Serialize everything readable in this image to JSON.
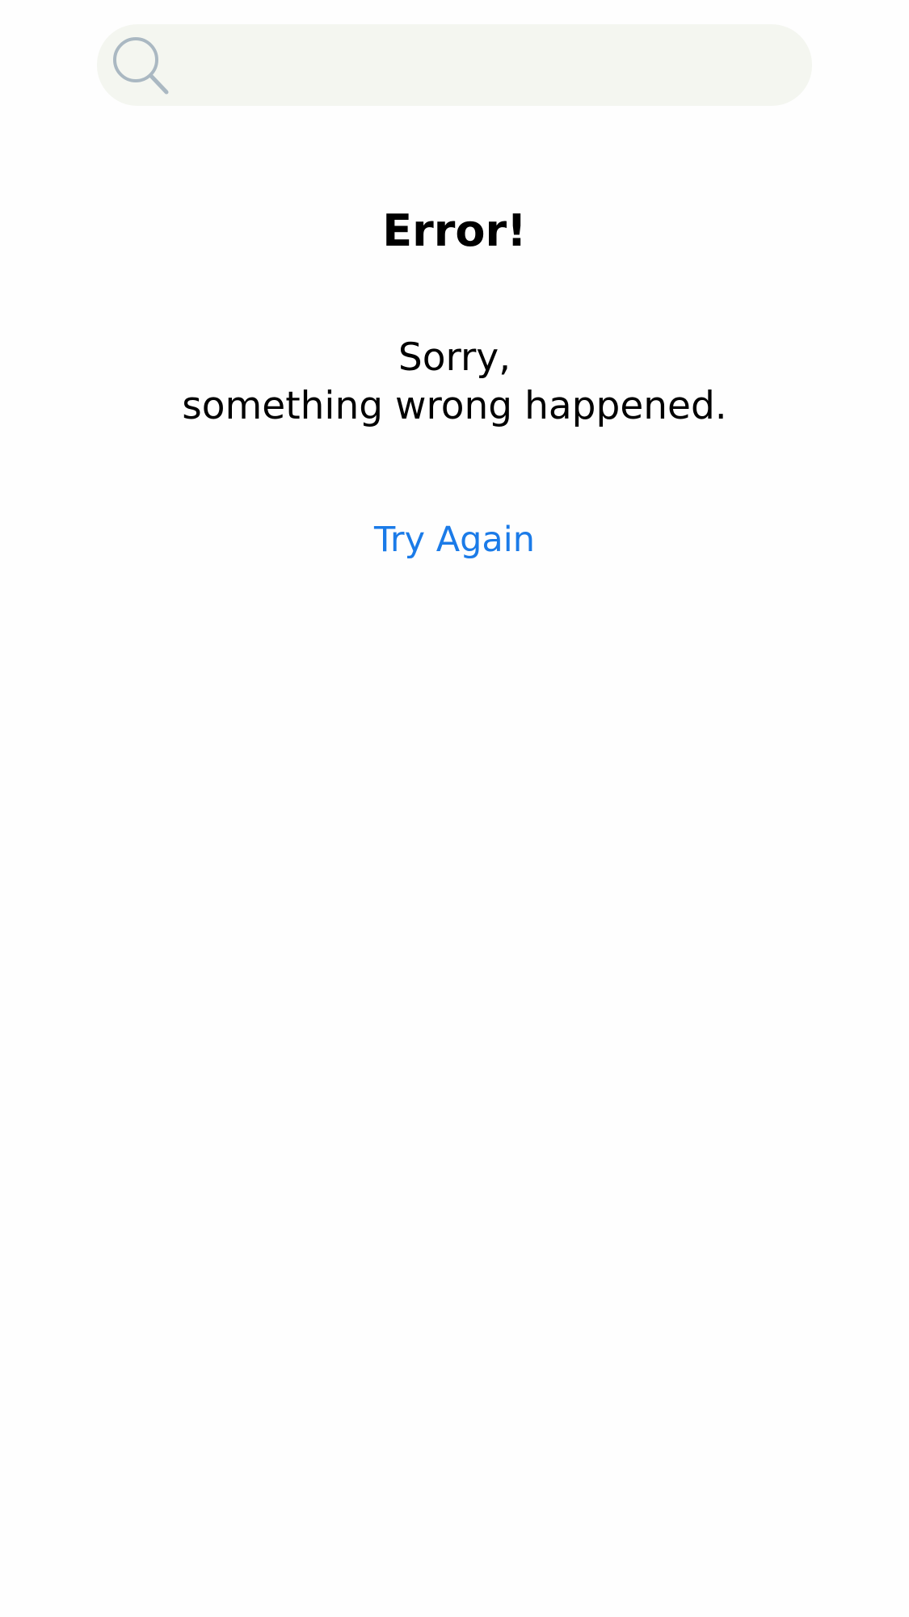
{
  "search": {
    "value": "",
    "placeholder": "",
    "icon": "search-icon"
  },
  "error": {
    "title": "Error!",
    "message_line1": "Sorry,",
    "message_line2": "something wrong happened.",
    "retry_label": "Try Again"
  },
  "colors": {
    "background": "#fefefe",
    "search_bar": "#f4f6f0",
    "search_icon": "#aab8c2",
    "accent": "#1b7be8",
    "text": "#000000"
  }
}
